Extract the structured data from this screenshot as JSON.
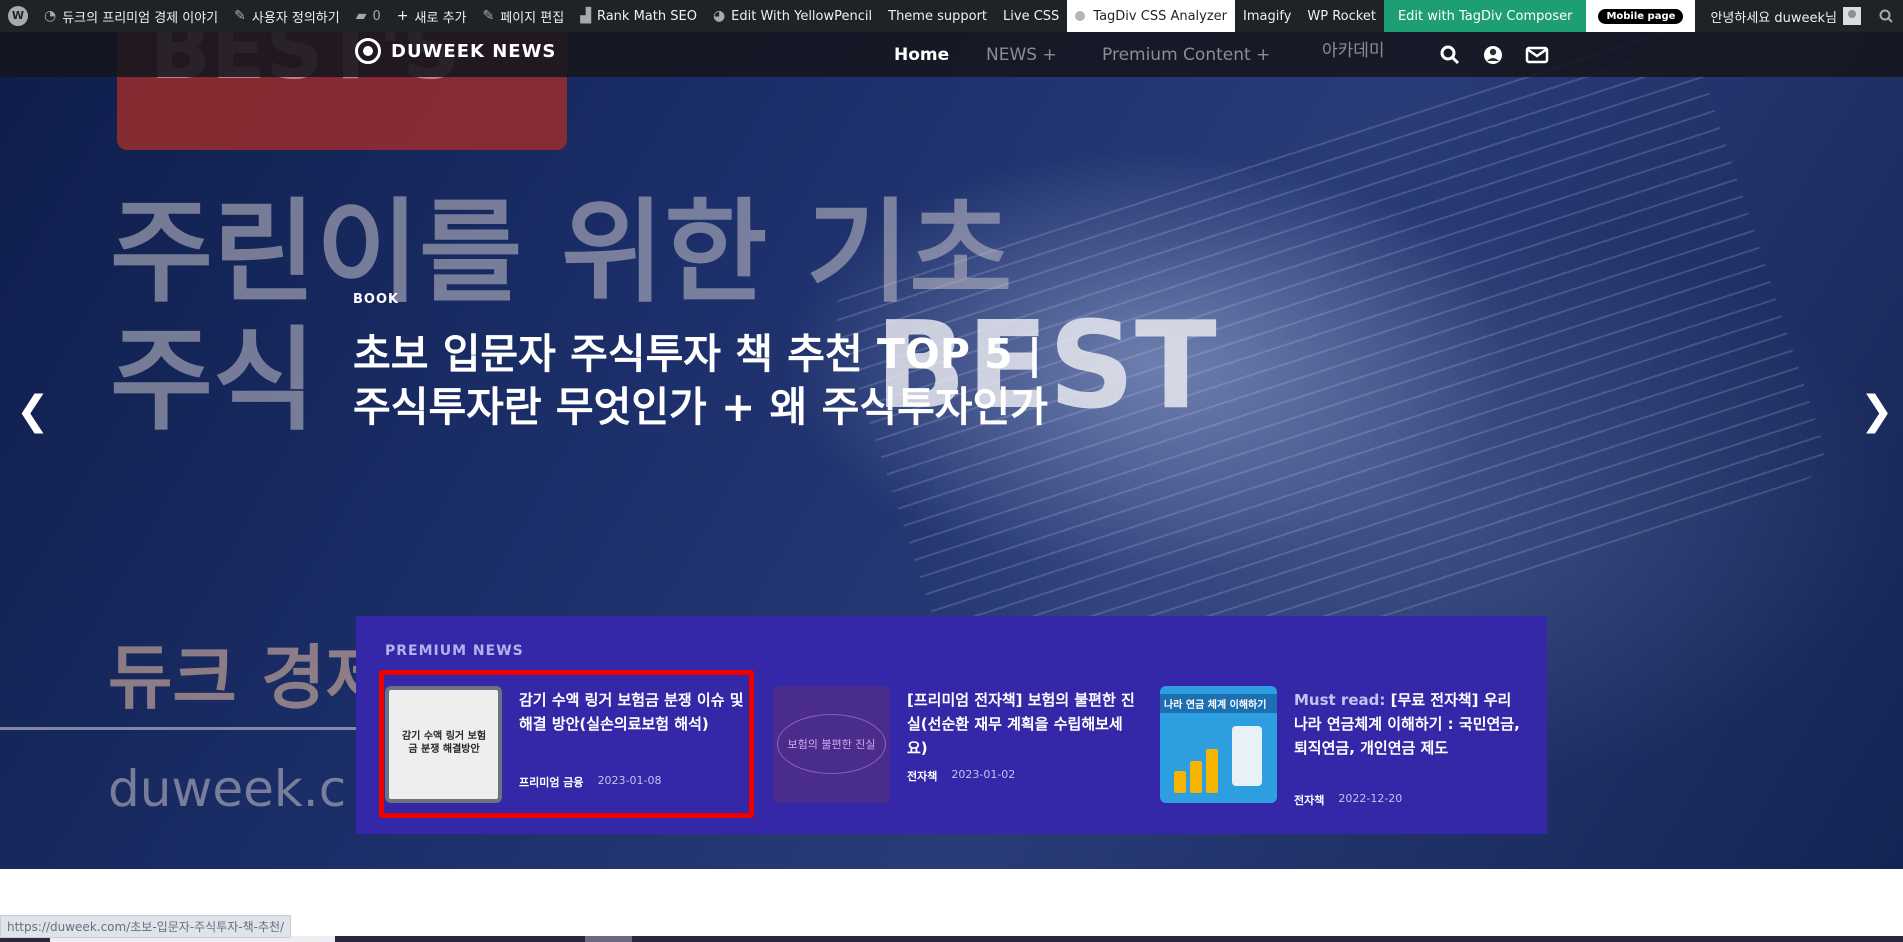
{
  "adminbar": {
    "items": [
      {
        "icon": "dashboard-icon",
        "label": "듀크의 프리미엄 경제 이야기"
      },
      {
        "icon": "brush-icon",
        "label": "사용자 정의하기"
      },
      {
        "icon": "comment-icon",
        "label": "0"
      },
      {
        "icon": "plus-icon",
        "label": "새로 추가"
      },
      {
        "icon": "pencil-icon",
        "label": "페이지 편집"
      },
      {
        "icon": "rankmath-icon",
        "label": "Rank Math SEO"
      },
      {
        "icon": "yellowpencil-icon",
        "label": "Edit With YellowPencil"
      },
      {
        "icon": "",
        "label": "Theme support"
      },
      {
        "icon": "",
        "label": "Live CSS"
      }
    ],
    "tagdiv_analyzer": "TagDiv CSS Analyzer",
    "imagify": "Imagify",
    "wp_rocket": "WP Rocket",
    "composer": "Edit with TagDiv Composer",
    "mobile_page": "Mobile page",
    "greeting": "안녕하세요 duweek님"
  },
  "site": {
    "logo_text": "DUWEEK NEWS",
    "nav": {
      "home": "Home",
      "news": "NEWS  +",
      "premium": "Premium Content  +",
      "academy": "아카데미"
    }
  },
  "hero_background": {
    "best_partial": "BEST'S",
    "line1": "주린이를 위한 기초",
    "line2": "주식",
    "best_big": "BEST",
    "brand": "듀크 경제",
    "url_partial": "duweek.c"
  },
  "slide": {
    "category": "BOOK",
    "headline": "초보 입문자 주식투자 책 추천 TOP 5 | 주식투자란 무엇인가 + 왜 주식투자인가",
    "prev": "❮",
    "next": "❯"
  },
  "premium_news": {
    "title": "PREMIUM NEWS",
    "cards": [
      {
        "thumb_text": "감기 수액 링거 보험금 분쟁 해결방안",
        "title": "감기 수액 링거 보험금 분쟁 이슈 및 해결 방안(실손의료보험 해석)",
        "category": "프리미엄 금융",
        "date": "2023-01-08"
      },
      {
        "thumb_text": "보험의 불편한 진실",
        "title": "[프리미엄 전자책] 보험의 불편한 진실(선순환 재무 계획을 수립해보세요)",
        "category": "전자책",
        "date": "2023-01-02"
      },
      {
        "thumb_text": "나라 연금 체계 이해하기",
        "must_read": "Must read:",
        "title": "[무료 전자책] 우리나라 연금체계 이해하기 : 국민연금, 퇴직연금, 개인연금 제도",
        "category": "전자책",
        "date": "2022-12-20"
      }
    ]
  },
  "status_url": "https://duweek.com/초보-입문자-주식투자-책-추천/",
  "colors": {
    "adminbar": "#1d2327",
    "composer": "#1e9e74",
    "premium_bg": "#3428a8",
    "highlight": "#ee0000"
  }
}
